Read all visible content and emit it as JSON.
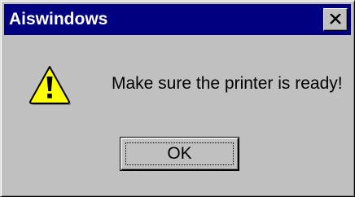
{
  "window": {
    "title": "Aiswindows",
    "titlebar_color": "#000080",
    "background_color": "#c0c0c0"
  },
  "titlebar": {
    "close_icon": "close-icon"
  },
  "dialog": {
    "icon": "warning-icon",
    "icon_color": "#ffff00",
    "message": "Make sure the printer is ready!"
  },
  "buttons": {
    "ok_label": "OK"
  }
}
